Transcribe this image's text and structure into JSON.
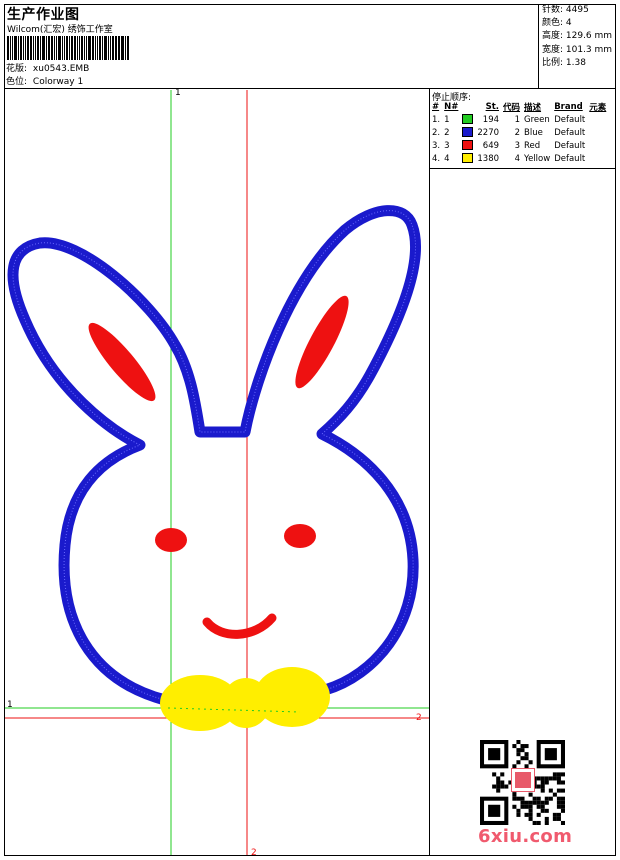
{
  "header": {
    "title": "生产作业图",
    "company": "Wilcom(汇宏) 绣饰工作室",
    "design_label": "花版:",
    "design_value": "xu0543.EMB",
    "colorway_label": "色位:",
    "colorway_value": "Colorway 1"
  },
  "stats": {
    "stitches": "针数: 4495",
    "colors": "颜色: 4",
    "height": "高度: 129.6 mm",
    "width": "宽度: 101.3 mm",
    "scale": "比例: 1.38"
  },
  "stop_sequence": {
    "title": "停止顺序:",
    "headers": [
      "#",
      "N#",
      "St.",
      "代码",
      "描述",
      "Brand",
      "元素"
    ],
    "rows": [
      {
        "num": "1.",
        "n": "1",
        "color": "#22cc22",
        "st": "194",
        "code": "1",
        "desc": "Green",
        "brand": "Default"
      },
      {
        "num": "2.",
        "n": "2",
        "color": "#1a1acc",
        "st": "2270",
        "code": "2",
        "desc": "Blue",
        "brand": "Default"
      },
      {
        "num": "3.",
        "n": "3",
        "color": "#ee1111",
        "st": "649",
        "code": "3",
        "desc": "Red",
        "brand": "Default"
      },
      {
        "num": "4.",
        "n": "4",
        "color": "#ffee00",
        "st": "1380",
        "code": "4",
        "desc": "Yellow",
        "brand": "Default"
      }
    ]
  },
  "guides": {
    "green_top": "1",
    "green_left": "1",
    "red_right": "2",
    "red_bottom": "2"
  },
  "watermark": "6xiu.com",
  "colors": {
    "outline": "#1a1acc",
    "accent": "#ee1111",
    "bow": "#ffee00",
    "guide_green": "#22cc22",
    "guide_red": "#ee1111"
  }
}
